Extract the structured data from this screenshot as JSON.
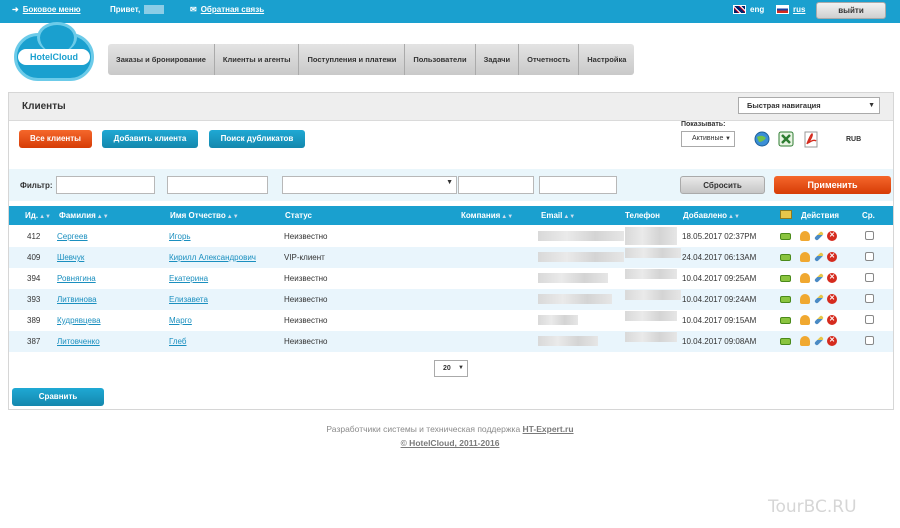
{
  "topbar": {
    "menu_label": "Боковое меню",
    "greeting": "Привет,",
    "feedback_label": "Обратная связь",
    "lang_en": "eng",
    "lang_ru": "rus",
    "logout_label": "выйти"
  },
  "logo": {
    "text": "HotelCloud"
  },
  "nav": [
    "Заказы и бронирование",
    "Клиенты и агенты",
    "Поступления и платежи",
    "Пользователи",
    "Задачи",
    "Отчетность",
    "Настройка"
  ],
  "page": {
    "title": "Клиенты",
    "quick_nav": "Быстрая навигация",
    "btn_all_clients": "Все клиенты",
    "btn_add_client": "Добавить клиента",
    "btn_find_duplicates": "Поиск дубликатов",
    "show_label": "Показывать:",
    "show_value": "Активные",
    "currency": "RUB"
  },
  "filter": {
    "label": "Фильтр:",
    "reset_label": "Сбросить",
    "apply_label": "Применить"
  },
  "table": {
    "headers": {
      "id": "Ид.",
      "lastname": "Фамилия",
      "name": "Имя Отчество",
      "status": "Статус",
      "company": "Компания",
      "email": "Email",
      "phone": "Телефон",
      "added": "Добавлено",
      "actions": "Действия",
      "compare": "Ср."
    },
    "rows": [
      {
        "id": "412",
        "lastname": "Сергеев",
        "name": "Игорь",
        "status": "Неизвестно",
        "added": "18.05.2017 02:37PM"
      },
      {
        "id": "409",
        "lastname": "Шевчук",
        "name": "Кирилл Александрович",
        "status": "VIP-клиент",
        "added": "24.04.2017 06:13AM"
      },
      {
        "id": "394",
        "lastname": "Ровнягина",
        "name": "Екатерина",
        "status": "Неизвестно",
        "added": "10.04.2017 09:25AM"
      },
      {
        "id": "393",
        "lastname": "Литвинова",
        "name": "Елизавета",
        "status": "Неизвестно",
        "added": "10.04.2017 09:24AM"
      },
      {
        "id": "389",
        "lastname": "Кудрявцева",
        "name": "Марго",
        "status": "Неизвестно",
        "added": "10.04.2017 09:15AM"
      },
      {
        "id": "387",
        "lastname": "Литовченко",
        "name": "Глеб",
        "status": "Неизвестно",
        "added": "10.04.2017 09:08AM"
      }
    ]
  },
  "pager": {
    "per_page": "20"
  },
  "compare_label": "Сравнить",
  "footer": {
    "line1_text": "Разработчики системы и техническая поддержка",
    "line1_link": "HT-Expert.ru",
    "line2": "© HotelCloud, 2011-2016"
  },
  "watermark": "TourBC.RU",
  "colors": {
    "accent": "#1aa0cf",
    "orange": "#e14d12",
    "row_alt": "#e9f5fc"
  }
}
